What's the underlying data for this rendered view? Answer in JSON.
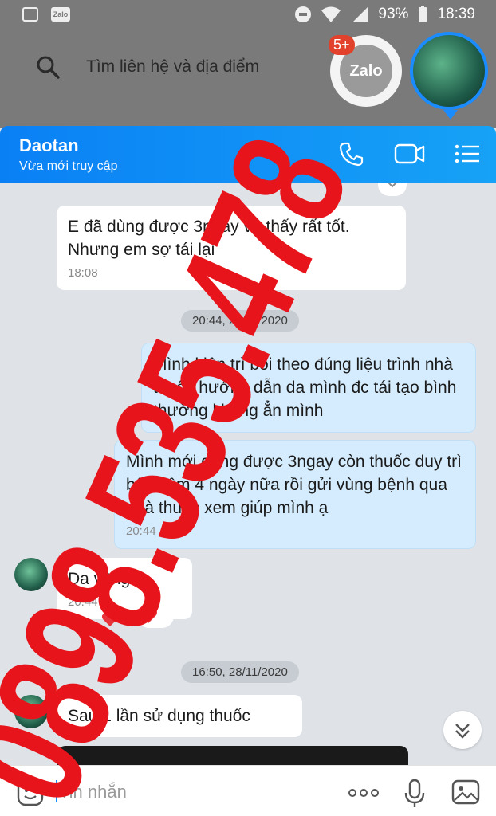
{
  "status_bar": {
    "battery": "93%",
    "time": "18:39",
    "app_mini": "Zalo"
  },
  "search": {
    "placeholder": "Tìm liên hệ và địa điểm"
  },
  "bubble": {
    "app_name": "Zalo",
    "badge": "5+"
  },
  "header": {
    "contact_name": "Daotan",
    "presence": "Vừa mới truy cập"
  },
  "messages": [
    {
      "text": "E đã dùng được 3ngay và thấy rất  tốt. Nhưng em sợ tái lại",
      "time": "18:08"
    },
    {
      "text": "Mình kiên trì bôi theo đúng liệu trình nhà thuốc hướng dẫn da mình đc tái tạo bình thường không ẳn mình"
    },
    {
      "text": "Mình mới dùng được 3ngay còn thuốc duy trì bôi thêm 4 ngày nữa rồi gửi vùng bệnh qua nhà thuốc xem giúp mình ạ",
      "time": "20:44"
    },
    {
      "text": "Da vâng",
      "time": "20:44"
    },
    {
      "text": "Sau 1 lần sử dụng thuốc"
    }
  ],
  "dates": [
    "20:44, 24/11/2020",
    "16:50, 28/11/2020"
  ],
  "composer": {
    "placeholder": "Tin nhắn"
  },
  "watermark": {
    "text": "0898.535.478",
    "color": "#e8141b"
  },
  "colors": {
    "header_start": "#0a80f5",
    "header_end": "#16a2f6",
    "outgoing_bg": "#d4ecfd",
    "badge": "#e2412b"
  }
}
